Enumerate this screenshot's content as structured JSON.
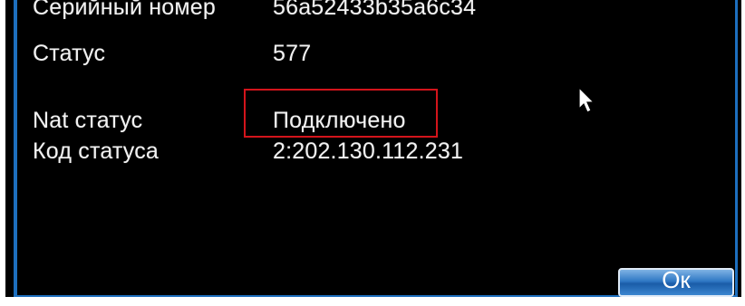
{
  "info": {
    "rows": [
      {
        "label": "Серийный номер",
        "value": "56a52433b35a6c34"
      },
      {
        "label": "Статус",
        "value": "577"
      },
      {
        "label": "Nat статус",
        "value": "Подключено"
      },
      {
        "label": "Код статуса",
        "value": "2:202.130.112.231"
      }
    ]
  },
  "dialog": {
    "ok_label": "Ок"
  },
  "colors": {
    "background": "#000000",
    "text": "#f2f2f2",
    "frame": "#1d6fbe",
    "highlight": "#d3141b",
    "button": "#2f78c4"
  },
  "icons": {
    "cursor": "mouse-pointer-icon"
  }
}
